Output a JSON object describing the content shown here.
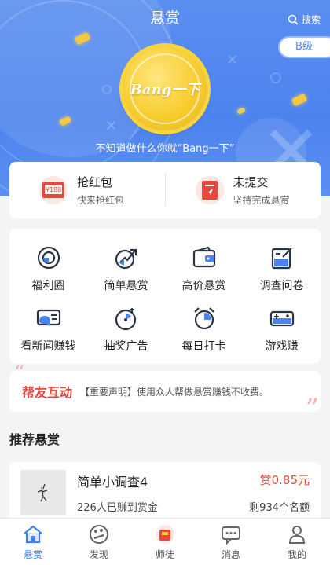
{
  "header": {
    "title": "悬赏",
    "search_label": "搜索",
    "level_badge": "B级",
    "coin_text": "Bang一下",
    "slogan": "不知道做什么你就“Bang一下”"
  },
  "quick_actions": [
    {
      "title": "抢红包",
      "subtitle": "快来抢红包",
      "icon": "red-envelope-icon",
      "badge": "¥188"
    },
    {
      "title": "未提交",
      "subtitle": "坚持完成悬赏",
      "icon": "document-icon"
    }
  ],
  "categories": [
    {
      "label": "福利圈",
      "icon": "target-circle-icon"
    },
    {
      "label": "简单悬赏",
      "icon": "trend-arrow-icon"
    },
    {
      "label": "高价悬赏",
      "icon": "wallet-icon"
    },
    {
      "label": "调查问卷",
      "icon": "edit-doc-icon"
    },
    {
      "label": "看新闻赚钱",
      "icon": "news-chat-icon"
    },
    {
      "label": "抽奖广告",
      "icon": "lottery-dial-icon"
    },
    {
      "label": "每日打卡",
      "icon": "alarm-clock-icon"
    },
    {
      "label": "游戏赚",
      "icon": "gamepad-icon"
    }
  ],
  "notice": {
    "title": "帮友互动",
    "text": "【重要声明】使用众人帮做悬赏赚钱不收费。"
  },
  "recommend": {
    "section_title": "推荐悬赏",
    "tasks": [
      {
        "name": "简单小调查4",
        "reward": "赏0.85元",
        "earned": "226人已赚到赏金",
        "remaining": "剩934个名额"
      }
    ]
  },
  "tabbar": [
    {
      "label": "悬赏",
      "icon": "home-icon",
      "active": true
    },
    {
      "label": "发现",
      "icon": "palette-icon",
      "active": false
    },
    {
      "label": "师徒",
      "icon": "mentor-gift-icon",
      "active": false
    },
    {
      "label": "消息",
      "icon": "message-icon",
      "active": false
    },
    {
      "label": "我的",
      "icon": "user-icon",
      "active": false
    }
  ],
  "colors": {
    "brand_blue": "#4c83ee",
    "accent_red": "#e8473b",
    "coin_gold": "#f7cd2e"
  }
}
